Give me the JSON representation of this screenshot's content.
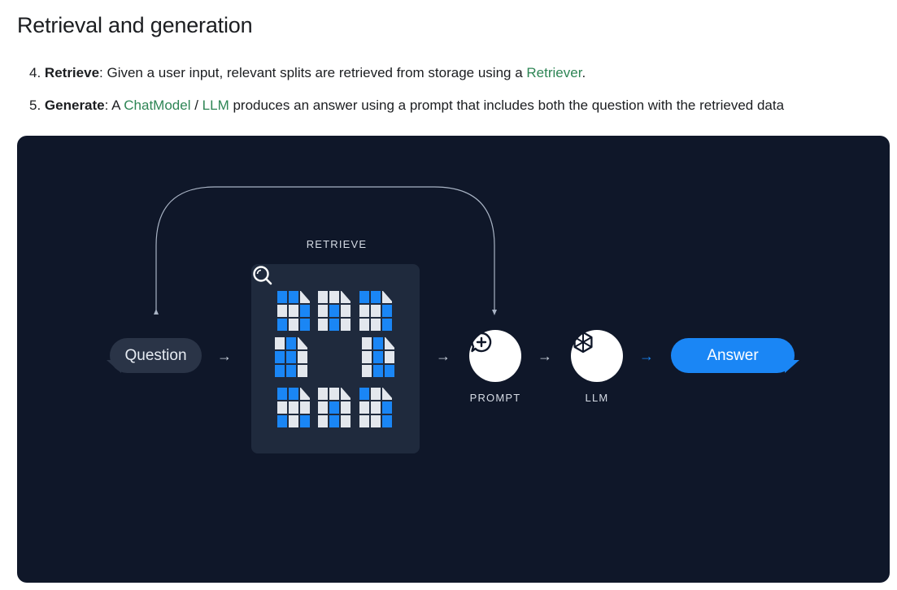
{
  "heading": "Retrieval and generation",
  "steps": [
    {
      "num": "4.",
      "bold": "Retrieve",
      "text_a": ": Given a user input, relevant splits are retrieved from storage using a ",
      "link1": "Retriever",
      "text_b": "."
    },
    {
      "num": "5.",
      "bold": "Generate",
      "text_a": ": A ",
      "link1": "ChatModel",
      "text_b": " / ",
      "link2": "LLM",
      "text_c": " produces an answer using a prompt that includes both the question with the retrieved data"
    }
  ],
  "diagram": {
    "question": "Question",
    "retrieve_label": "RETRIEVE",
    "prompt_label": "PROMPT",
    "llm_label": "LLM",
    "answer": "Answer",
    "arrow_glyph": "→",
    "icons": [
      "document-icon",
      "magnifier-icon",
      "chat-plus-icon",
      "hexagon-icon"
    ],
    "colors": {
      "background": "#0f1729",
      "panel": "#1f2a3d",
      "question_bubble": "#2a3447",
      "answer_bubble": "#1a86f5",
      "link": "#2e8555",
      "doc_blue": "#1a86f5",
      "doc_grey": "#e3e7ed"
    }
  }
}
